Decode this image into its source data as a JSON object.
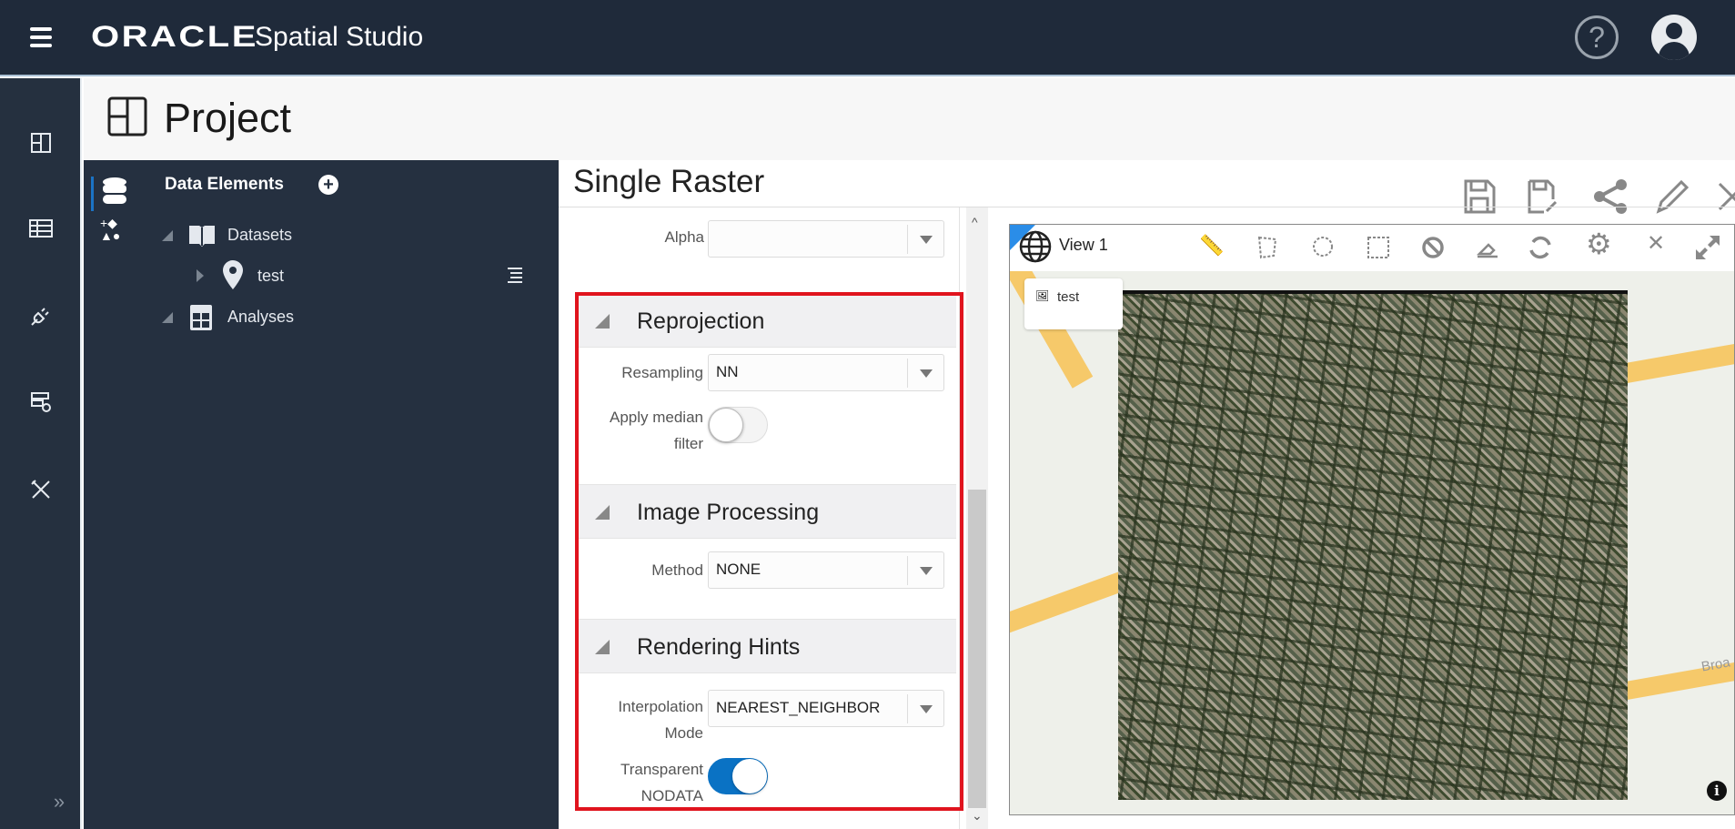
{
  "app": {
    "brand": "ORACLE",
    "product": "Spatial Studio"
  },
  "page": {
    "title": "Project"
  },
  "data_panel": {
    "title": "Data Elements",
    "tree": [
      {
        "label": "Datasets",
        "children": [
          {
            "label": "test"
          }
        ]
      },
      {
        "label": "Analyses"
      }
    ]
  },
  "editor": {
    "title": "Single Raster",
    "alpha": {
      "label": "Alpha",
      "value": ""
    },
    "sections": {
      "reprojection": {
        "title": "Reprojection",
        "resampling_label": "Resampling",
        "resampling_value": "NN",
        "median_label_1": "Apply median",
        "median_label_2": "filter",
        "median_on": false
      },
      "image_processing": {
        "title": "Image Processing",
        "method_label": "Method",
        "method_value": "NONE"
      },
      "rendering_hints": {
        "title": "Rendering Hints",
        "interp_label_1": "Interpolation",
        "interp_label_2": "Mode",
        "interp_value": "NEAREST_NEIGHBOR",
        "nodata_label_1": "Transparent",
        "nodata_label_2": "NODATA",
        "nodata_on": true
      }
    }
  },
  "map": {
    "view_title": "View 1",
    "layer_label": "test",
    "street_label": "Broa"
  },
  "colors": {
    "header": "#1f2a3a",
    "panel": "#253040",
    "accent": "#0a72c4",
    "highlight": "#e0141e"
  }
}
